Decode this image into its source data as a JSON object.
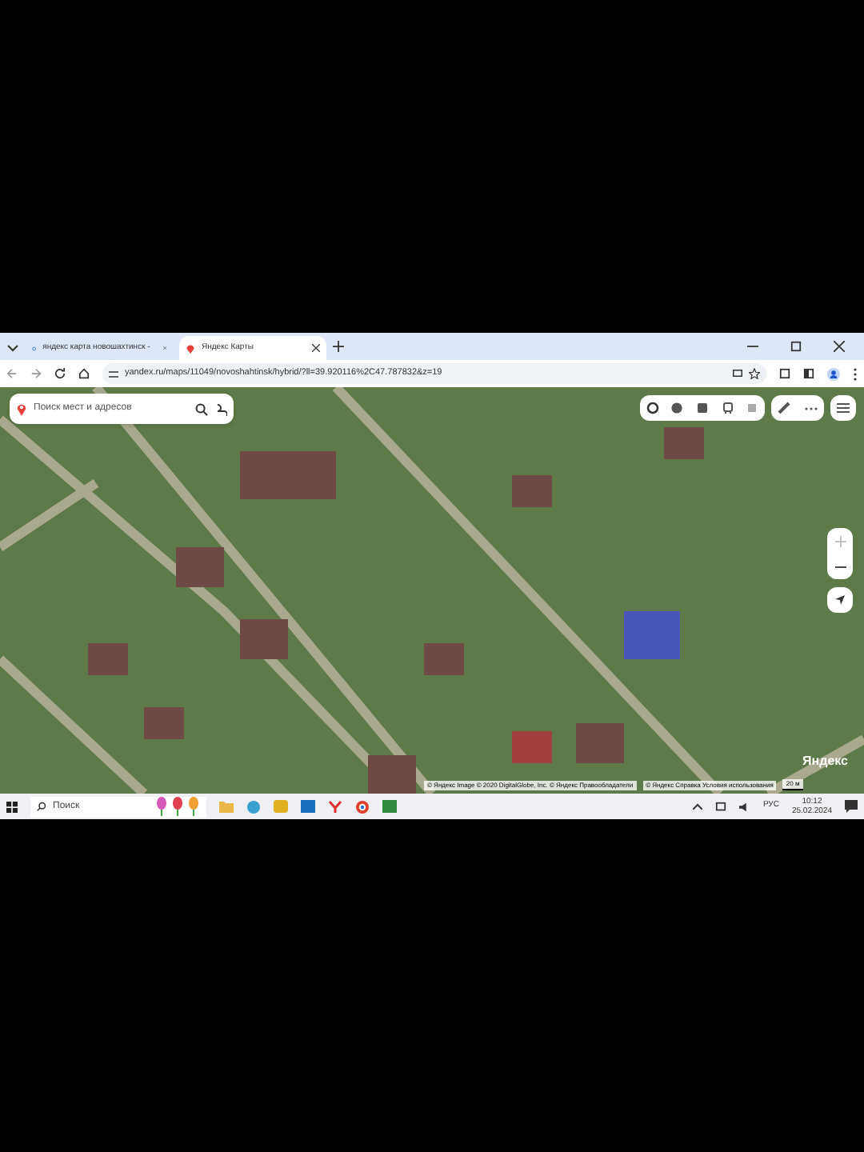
{
  "browser": {
    "tabs": [
      {
        "title": "яндекс карта новошахтинск -",
        "selected": false
      },
      {
        "title": "Яндекс Карты",
        "selected": true
      }
    ],
    "address": "yandex.ru/maps/11049/novoshahtinsk/hybrid/?ll=39.920116%2C47.787832&z=19"
  },
  "map": {
    "search": {
      "placeholder": "Поиск мест и адресов"
    },
    "logo": "Яндекс",
    "copyright": "© Яндекс Image © 2020 DigitalGlobe, Inc. © Яндекс  Правообладатели",
    "links": "© Яндекс  Справка  Условия использования",
    "scale": "20 м"
  },
  "taskbar": {
    "search": "Поиск",
    "language": "РУС",
    "time": "10:12",
    "date": "25.02.2024"
  }
}
